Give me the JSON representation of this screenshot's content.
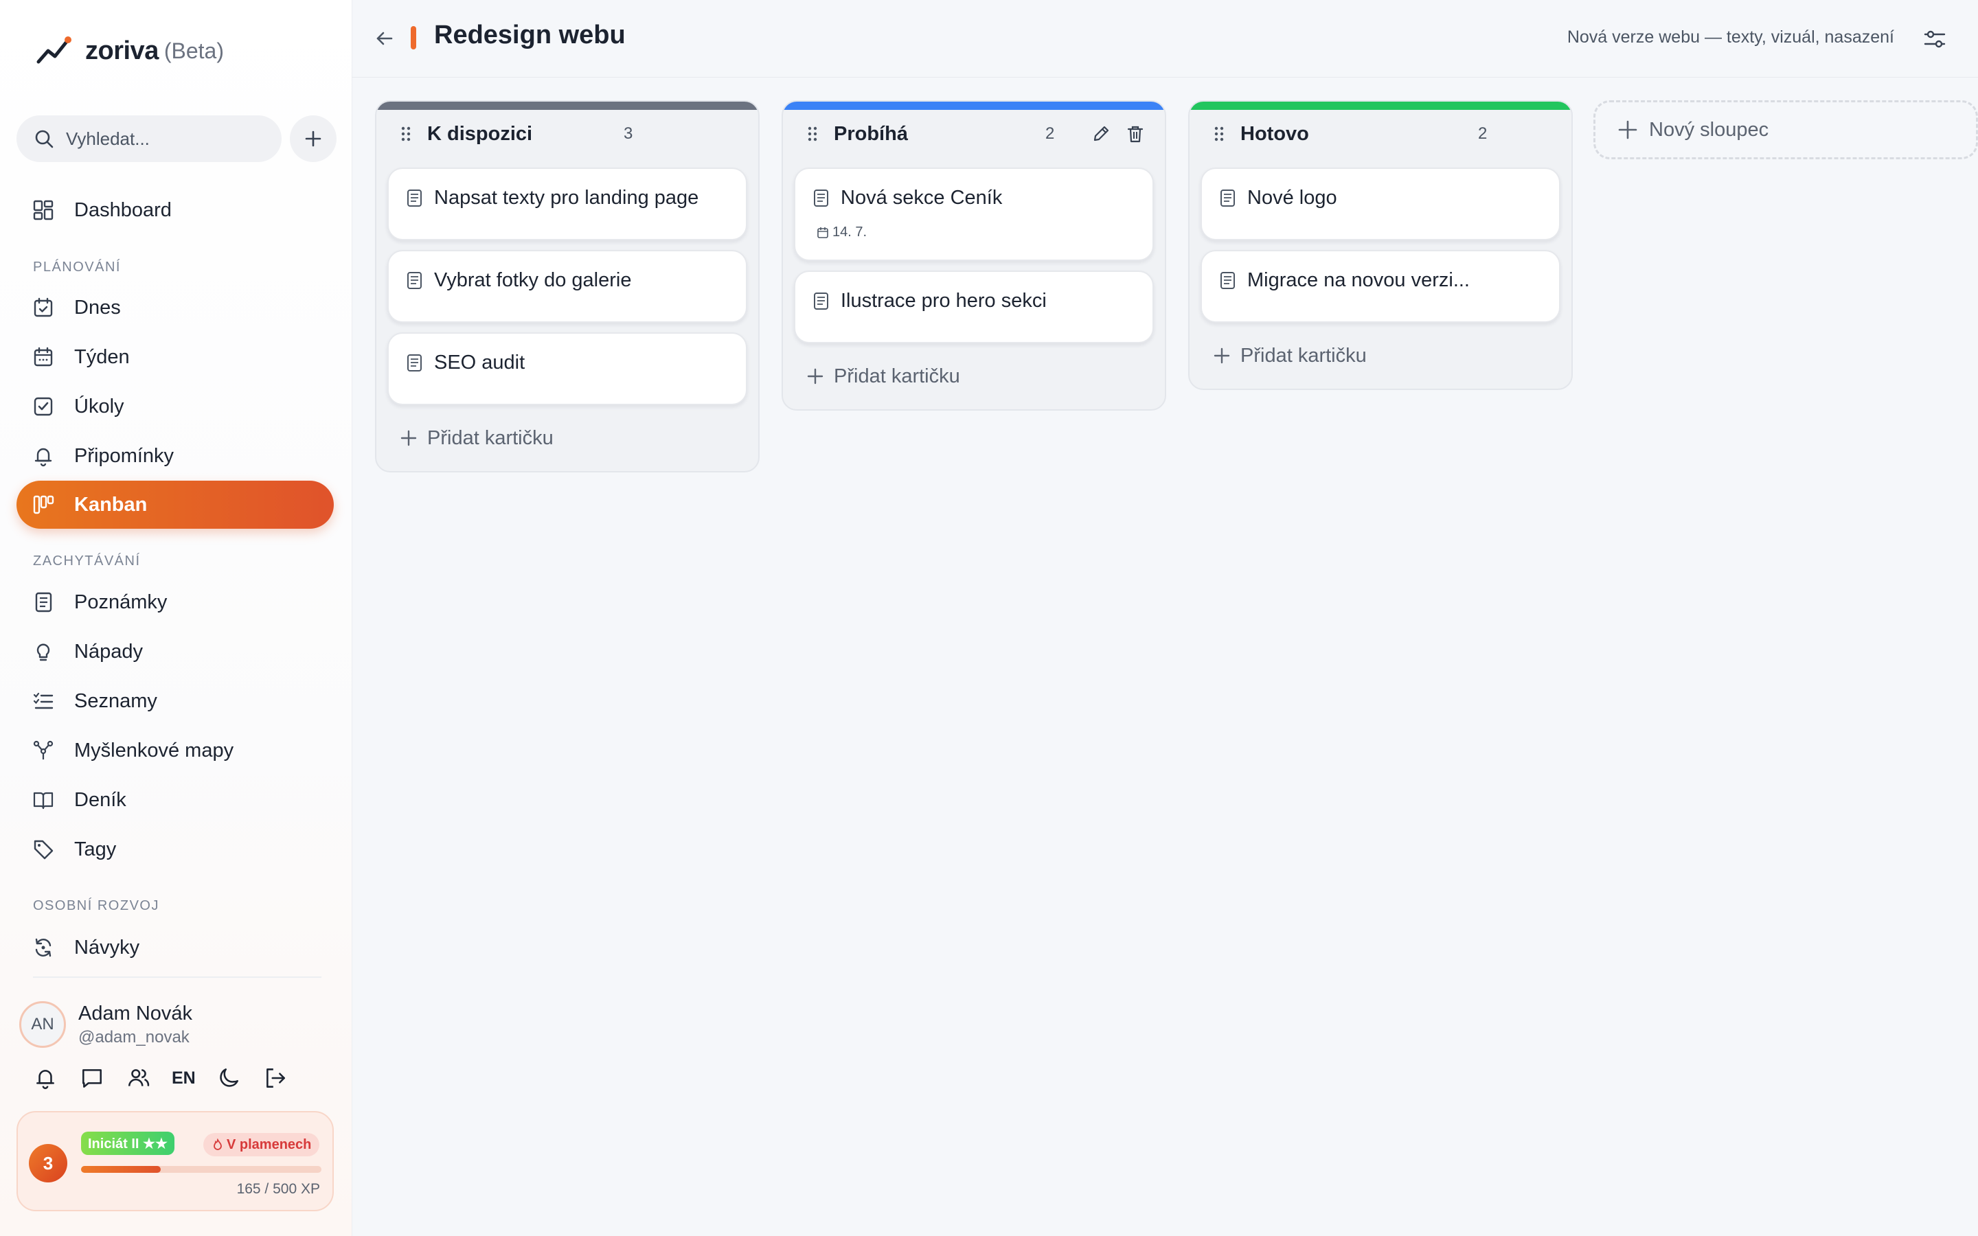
{
  "app": {
    "name": "zoriva",
    "tag": "(Beta)"
  },
  "search": {
    "placeholder": "Vyhledat..."
  },
  "nav": {
    "dashboard": "Dashboard",
    "section_planning": "PLÁNOVÁNÍ",
    "today": "Dnes",
    "week": "Týden",
    "tasks": "Úkoly",
    "reminders": "Připomínky",
    "kanban": "Kanban",
    "section_capture": "ZACHYTÁVÁNÍ",
    "notes": "Poznámky",
    "ideas": "Nápady",
    "lists": "Seznamy",
    "mindmaps": "Myšlenkové mapy",
    "journal": "Deník",
    "tags": "Tagy",
    "section_growth": "OSOBNÍ ROZVOJ",
    "habits": "Návyky"
  },
  "user": {
    "initials": "AN",
    "name": "Adam Novák",
    "handle": "@adam_novak",
    "lang": "EN"
  },
  "gamification": {
    "level": "3",
    "badge_rank": "Iniciát II ★★",
    "badge_streak": "V plamenech",
    "xp_text": "165 / 500 XP",
    "xp_progress": 0.33
  },
  "board": {
    "title": "Redesign webu",
    "description": "Nová verze webu — texty, vizuál, nasazení",
    "accent": "#ee6a2c",
    "add_card_label": "Přidat kartičku",
    "new_column_label": "Nový sloupec",
    "columns": [
      {
        "title": "K dispozici",
        "count": "3",
        "color": "#6b7280",
        "cards": [
          {
            "title": "Napsat texty pro landing page"
          },
          {
            "title": "Vybrat fotky do galerie"
          },
          {
            "title": "SEO audit"
          }
        ]
      },
      {
        "title": "Probíhá",
        "count": "2",
        "color": "#3b82f6",
        "cards": [
          {
            "title": "Nová sekce Ceník",
            "date": "14. 7."
          },
          {
            "title": "Ilustrace pro hero sekci"
          }
        ]
      },
      {
        "title": "Hotovo",
        "count": "2",
        "color": "#22c55e",
        "cards": [
          {
            "title": "Nové logo"
          },
          {
            "title": "Migrace na novou verzi..."
          }
        ]
      }
    ]
  }
}
